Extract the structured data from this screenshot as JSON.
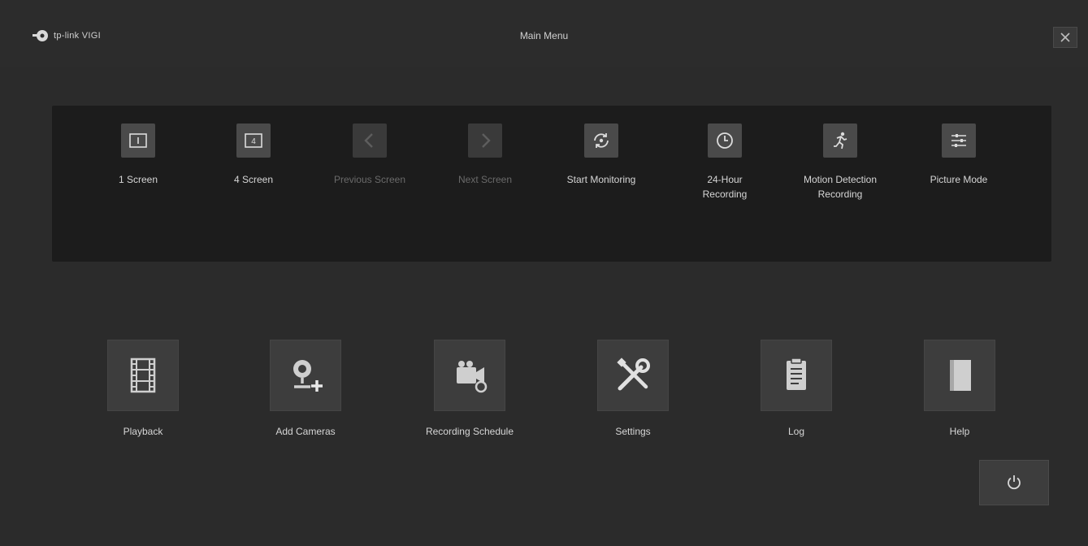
{
  "window": {
    "brand": "tp-link VIGI",
    "title": "Main Menu"
  },
  "quick_actions": [
    {
      "label": "1 Screen",
      "icon": "single-screen-icon",
      "enabled": true
    },
    {
      "label": "4 Screen",
      "icon": "quad-screen-icon",
      "enabled": true
    },
    {
      "label": "Previous Screen",
      "icon": "chevron-left-icon",
      "enabled": false
    },
    {
      "label": "Next Screen",
      "icon": "chevron-right-icon",
      "enabled": false
    },
    {
      "label": "Start Monitoring",
      "icon": "monitoring-cycle-icon",
      "enabled": true
    },
    {
      "label": "24-Hour\nRecording",
      "icon": "clock-icon",
      "enabled": true
    },
    {
      "label": "Motion Detection\nRecording",
      "icon": "running-person-icon",
      "enabled": true
    },
    {
      "label": "Picture Mode",
      "icon": "sliders-icon",
      "enabled": true
    }
  ],
  "main_menu": [
    {
      "label": "Playback",
      "icon": "film-strip-icon"
    },
    {
      "label": "Add Cameras",
      "icon": "add-camera-icon"
    },
    {
      "label": "Recording Schedule",
      "icon": "video-camera-settings-icon"
    },
    {
      "label": "Settings",
      "icon": "wrench-screwdriver-icon"
    },
    {
      "label": "Log",
      "icon": "clipboard-icon"
    },
    {
      "label": "Help",
      "icon": "book-icon"
    }
  ],
  "power": {
    "icon": "power-icon"
  },
  "colors": {
    "background": "#2b2b2b",
    "panel": "#1c1c1c",
    "tile": "#3d3d3d",
    "text": "#d6d6d6",
    "disabled_text": "#6a6a6a"
  }
}
